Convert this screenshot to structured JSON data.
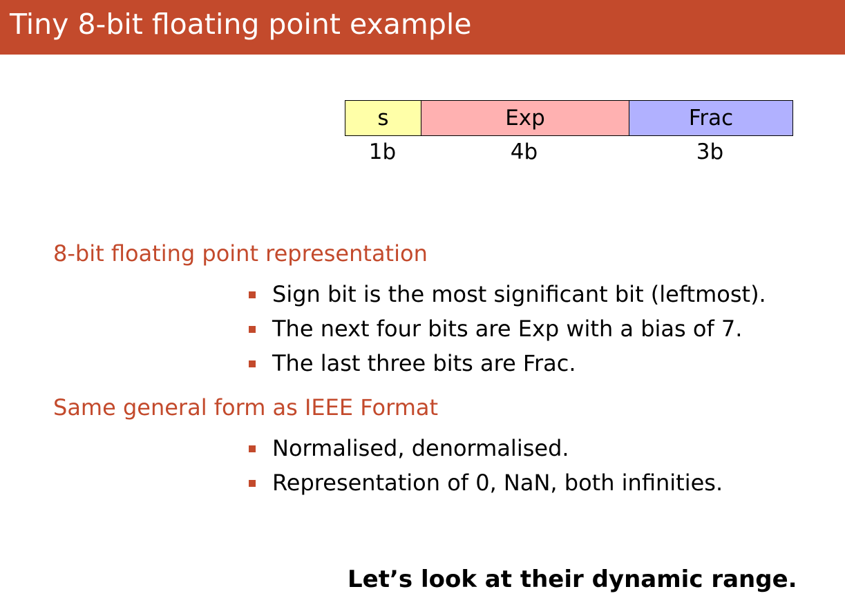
{
  "slide": {
    "title": "Tiny 8-bit floating point example",
    "colors": {
      "accent": "#c34a2c",
      "title_text": "#ffffff"
    }
  },
  "bit_layout": {
    "fields": [
      {
        "label": "s",
        "bits": "1b",
        "color": "#ffffa8"
      },
      {
        "label": "Exp",
        "bits": "4b",
        "color": "#ffb1b1"
      },
      {
        "label": "Frac",
        "bits": "3b",
        "color": "#b1b1ff"
      }
    ]
  },
  "sections": [
    {
      "heading": "8-bit floating point representation",
      "bullets": [
        "Sign bit is the most significant bit (leftmost).",
        "The next four bits are Exp with a bias of 7.",
        "The last three bits are Frac."
      ]
    },
    {
      "heading": "Same general form as IEEE Format",
      "bullets": [
        "Normalised, denormalised.",
        "Representation of 0, NaN, both infinities."
      ]
    }
  ],
  "closing": "Let’s look at their dynamic range."
}
